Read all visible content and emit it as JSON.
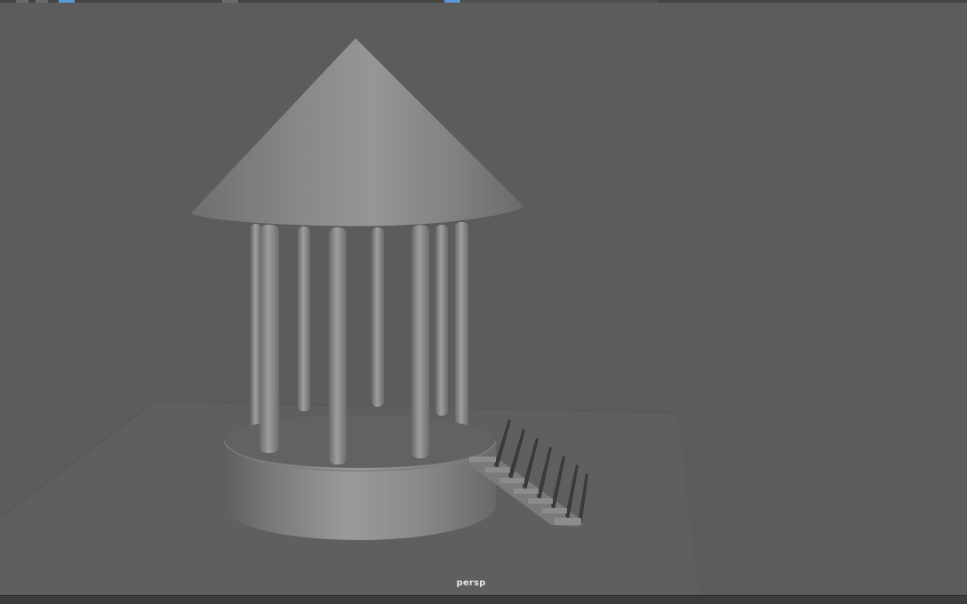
{
  "viewport": {
    "camera_label": "persp"
  },
  "toolbar": {
    "icons": [
      "select-tool-icon",
      "lasso-tool-icon",
      "paint-select-icon",
      "move-tool-icon",
      "snap-icon"
    ]
  },
  "scene": {
    "objects": [
      "ground-plane",
      "round-base",
      "column",
      "cone-roof",
      "staircase"
    ],
    "column_count": 9,
    "stair_step_count": 7
  },
  "colors": {
    "viewport_bg": "#5c5c5c",
    "ground": "#5f5f5f",
    "geometry_light": "#9a9a9a",
    "geometry_dark": "#5e5e5e",
    "label": "#e6e6e6"
  }
}
